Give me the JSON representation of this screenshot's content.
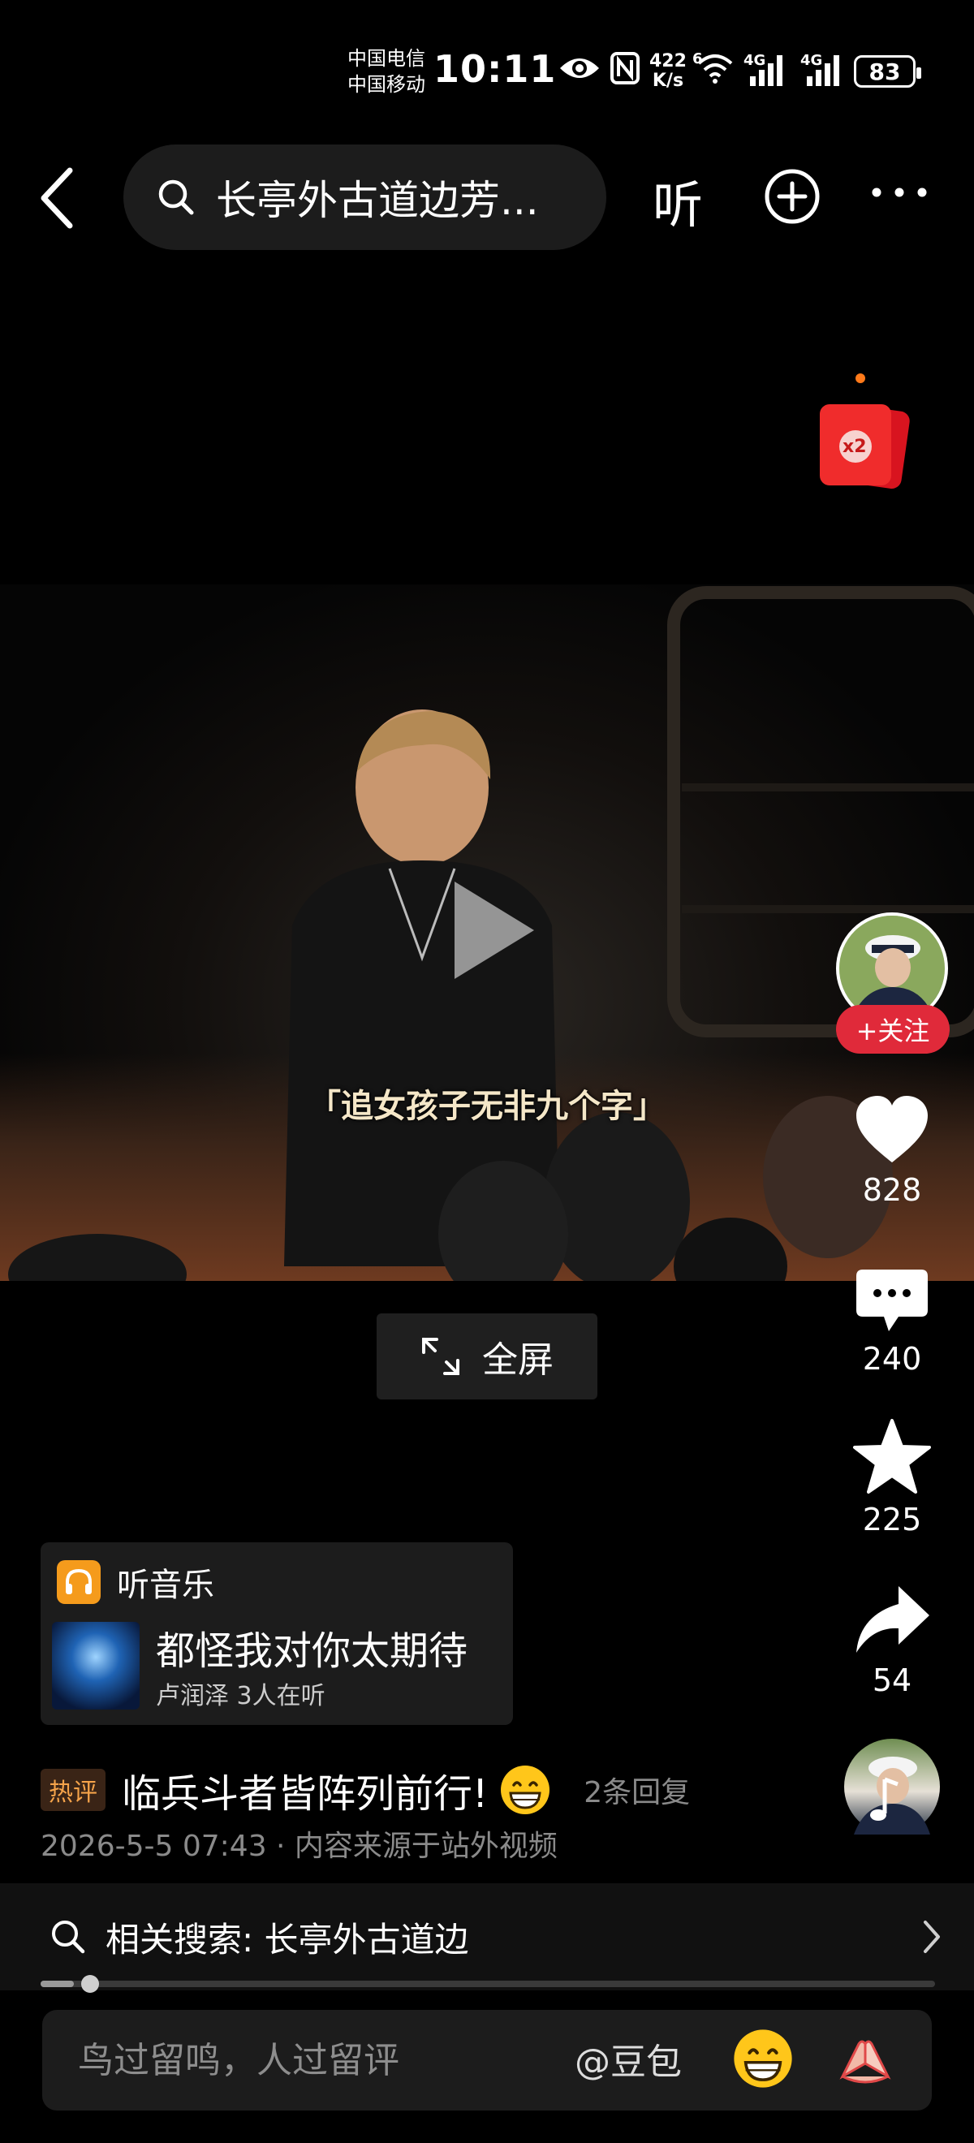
{
  "status_bar": {
    "carrier1": "中国电信",
    "carrier2": "中国移动",
    "time": "10:11",
    "speed_value": "422",
    "speed_unit": "K/s",
    "signal1": "4G",
    "signal2": "4G",
    "wifi_badge": "6",
    "battery": "83"
  },
  "header": {
    "search_text": "长亭外古道边芳...",
    "listen_label": "听"
  },
  "red_packet": {
    "multiplier": "x2"
  },
  "video": {
    "subtitle": "「追女孩子无非九个字」",
    "fullscreen_label": "全屏"
  },
  "rail": {
    "follow_label": "+关注",
    "likes": "828",
    "comments": "240",
    "favorites": "225",
    "shares": "54"
  },
  "music": {
    "header": "听音乐",
    "song": "都怪我对你太期待",
    "subline": "卢润泽 3人在听"
  },
  "hot_comment": {
    "badge": "热评",
    "text": "临兵斗者皆阵列前行!",
    "reply_count": "2条回复",
    "meta": "2026-5-5 07:43 · 内容来源于站外视频"
  },
  "related": {
    "label": "相关搜索: 长亭外古道边"
  },
  "progress": {
    "fraction": 0.037
  },
  "comment_input": {
    "placeholder": "鸟过留鸣，人过留评",
    "mention": "@豆包"
  },
  "colors": {
    "follow": "#e02a3a",
    "like": "#ffffff",
    "music_icon": "#f59b1c",
    "hot_badge_text": "#f5a34a"
  }
}
